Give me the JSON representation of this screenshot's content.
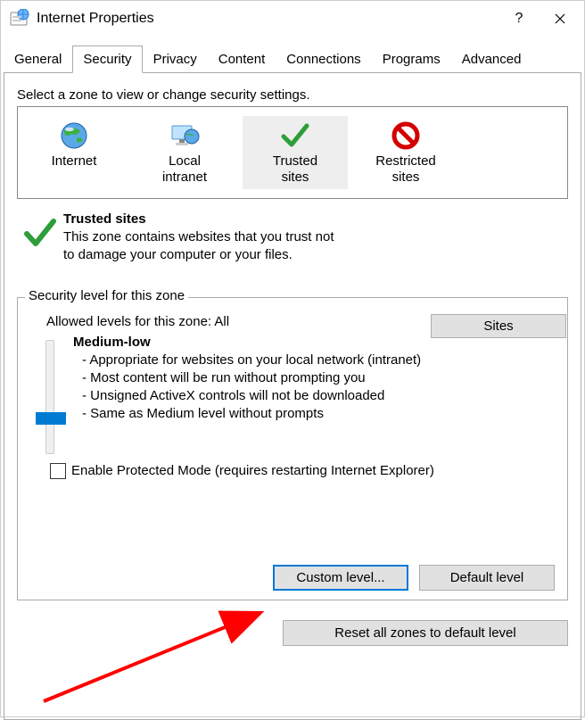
{
  "title": "Internet Properties",
  "tabs": [
    "General",
    "Security",
    "Privacy",
    "Content",
    "Connections",
    "Programs",
    "Advanced"
  ],
  "active_tab": 1,
  "zone_instruction": "Select a zone to view or change security settings.",
  "zones": [
    {
      "name": "Internet",
      "icon": "globe"
    },
    {
      "name": "Local\nintranet",
      "icon": "monitor"
    },
    {
      "name": "Trusted\nsites",
      "icon": "check"
    },
    {
      "name": "Restricted\nsites",
      "icon": "ban"
    }
  ],
  "selected_zone": 2,
  "zone_detail": {
    "title": "Trusted sites",
    "body": "This zone contains websites that you trust not to damage your computer or your files."
  },
  "sites_button": "Sites",
  "group_title": "Security level for this zone",
  "allowed_label": "Allowed levels for this zone: All",
  "level_name": "Medium-low",
  "level_bullets": [
    "- Appropriate for websites on your local network (intranet)",
    "- Most content will be run without prompting you",
    "- Unsigned ActiveX controls will not be downloaded",
    "- Same as Medium level without prompts"
  ],
  "protected_mode_label": "Enable Protected Mode (requires restarting Internet Explorer)",
  "protected_mode_checked": false,
  "custom_level_label": "Custom level...",
  "default_level_label": "Default level",
  "reset_label": "Reset all zones to default level"
}
